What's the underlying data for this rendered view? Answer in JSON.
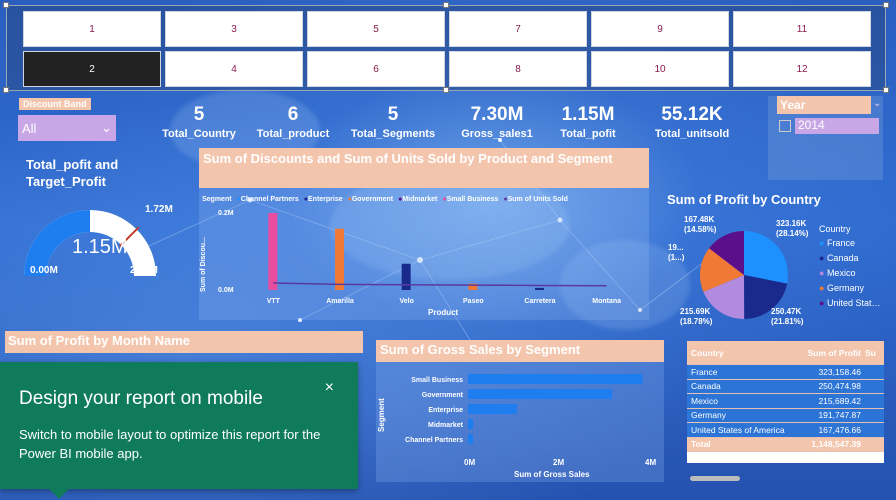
{
  "months": {
    "row1": [
      "1",
      "3",
      "5",
      "7",
      "9",
      "11"
    ],
    "row2": [
      "2",
      "4",
      "6",
      "8",
      "10",
      "12"
    ],
    "selected": "2"
  },
  "discount_band": {
    "label": "Discount Band",
    "value": "All"
  },
  "year": {
    "label": "Year",
    "option": "2014"
  },
  "kpis": [
    {
      "value": "5",
      "label": "Total_Country"
    },
    {
      "value": "6",
      "label": "Total_product"
    },
    {
      "value": "5",
      "label": "Total_Segments"
    },
    {
      "value": "7.30M",
      "label": "Gross_sales1"
    },
    {
      "value": "1.15M",
      "label": "Total_pofit"
    },
    {
      "value": "55.12K",
      "label": "Total_unitsold"
    }
  ],
  "gauge": {
    "title_line1": "Total_pofit and",
    "title_line2": "Target_Profit",
    "value": "1.15M",
    "min": "0.00M",
    "max": "2.30M",
    "target": "1.72M",
    "fill_fraction": 0.5,
    "target_fraction": 0.75
  },
  "discounts_chart": {
    "title": "Sum of Discounts and Sum of Units Sold by Product and Segment",
    "legend_title": "Segment",
    "legend": [
      "Channel Partners",
      "Enterprise",
      "Government",
      "Midmarket",
      "Small Business",
      "Sum of Units Sold"
    ],
    "ylabel": "Sum of Discou...",
    "xlabel": "Product",
    "yticks": [
      "0.2M",
      "0.0M"
    ],
    "categories": [
      "VTT",
      "Amarilla",
      "Velo",
      "Paseo",
      "Carretera",
      "Montana"
    ]
  },
  "profit_country_chart": {
    "title": "Sum of Profit by Country",
    "legend_title": "Country",
    "labels": [
      "167.48K (14.58%)",
      "19... (1...)",
      "215.69K (18.78%)",
      "250.47K (21.81%)",
      "323.16K (28.14%)"
    ]
  },
  "profit_month_chart": {
    "title": "Sum of Profit by Month Name"
  },
  "gross_sales_chart": {
    "title": "Sum of Gross Sales by Segment",
    "ylabel": "Segment",
    "xlabel": "Sum of Gross Sales",
    "xticks": [
      "0M",
      "2M",
      "4M"
    ]
  },
  "table": {
    "headers": [
      "Country",
      "Sum of Profit",
      "Su"
    ],
    "total_label": "Total",
    "total_value": "1,148,547.39"
  },
  "chart_data": [
    {
      "type": "bar",
      "title": "Sum of Discounts and Sum of Units Sold by Product and Segment",
      "xlabel": "Product",
      "ylabel": "Sum of Discou...",
      "ylim": [
        0,
        0.2
      ],
      "categories": [
        "VTT",
        "Amarilla",
        "Velo",
        "Paseo",
        "Carretera",
        "Montana"
      ],
      "series": [
        {
          "name": "Channel Partners",
          "values": [
            0,
            0,
            0,
            0,
            0,
            0
          ]
        },
        {
          "name": "Enterprise",
          "values": [
            0,
            0,
            0.075,
            0,
            0.006,
            0
          ]
        },
        {
          "name": "Government",
          "values": [
            0,
            0.175,
            0,
            0.018,
            0,
            0
          ]
        },
        {
          "name": "Midmarket",
          "values": [
            0,
            0,
            0,
            0,
            0,
            0
          ]
        },
        {
          "name": "Small Business",
          "values": [
            0.22,
            0,
            0,
            0,
            0,
            0
          ]
        }
      ],
      "line_series": {
        "name": "Sum of Units Sold",
        "values": [
          0.02,
          0.016,
          0.015,
          0.014,
          0.013,
          0.012
        ]
      },
      "legend_position": "top"
    },
    {
      "type": "pie",
      "title": "Sum of Profit by Country",
      "categories": [
        "France",
        "Canada",
        "Mexico",
        "Germany",
        "United States of America"
      ],
      "values": [
        323.16,
        250.47,
        215.69,
        191.75,
        167.48
      ],
      "colors": [
        "#1e90ff",
        "#1a2a8c",
        "#b28be0",
        "#f07a35",
        "#5b0f8a"
      ],
      "legend_position": "right"
    },
    {
      "type": "bar",
      "orientation": "horizontal",
      "title": "Sum of Gross Sales by Segment",
      "xlabel": "Sum of Gross Sales",
      "ylabel": "Segment",
      "categories": [
        "Small Business",
        "Government",
        "Enterprise",
        "Midmarket",
        "Channel Partners"
      ],
      "values": [
        3.75,
        3.1,
        1.05,
        0.1,
        0.1
      ],
      "xlim": [
        0,
        4
      ]
    },
    {
      "type": "table",
      "title": "Country / Sum of Profit",
      "columns": [
        "Country",
        "Sum of Profit"
      ],
      "rows": [
        [
          "France",
          "323,158.46"
        ],
        [
          "Canada",
          "250,474.98"
        ],
        [
          "Mexico",
          "215,689.42"
        ],
        [
          "Germany",
          "191,747.87"
        ],
        [
          "United States of America",
          "167,476.66"
        ]
      ],
      "total": "1,148,547.39"
    }
  ],
  "toast": {
    "title": "Design your report on mobile",
    "body": "Switch to mobile layout to optimize this report for the Power BI mobile app.",
    "close": "×"
  }
}
